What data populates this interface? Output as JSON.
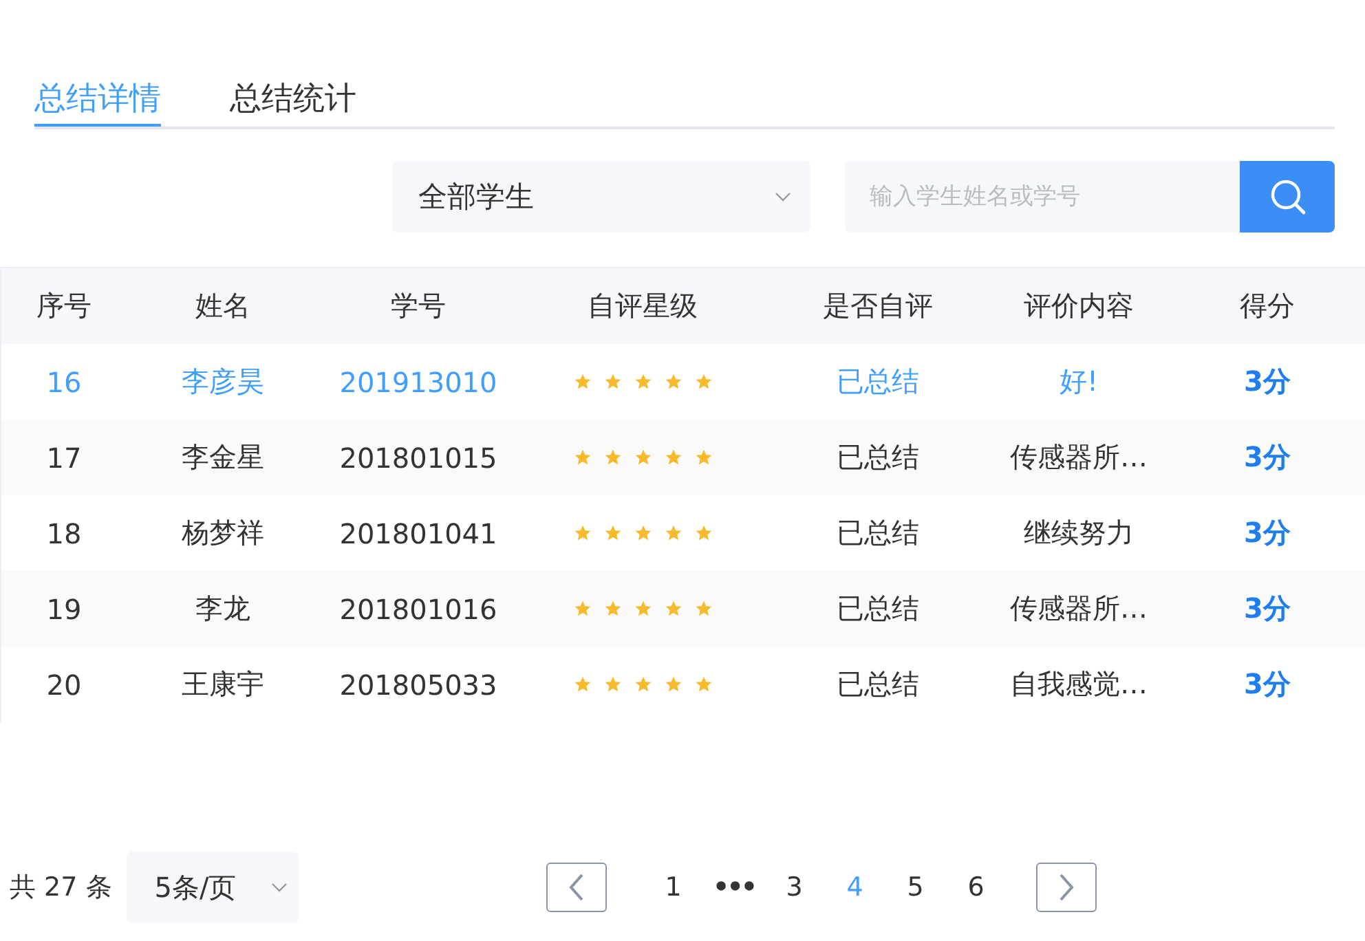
{
  "tabs": [
    {
      "label": "总结详情",
      "selected": true
    },
    {
      "label": "总结统计",
      "selected": false
    }
  ],
  "filter": {
    "value": "全部学生"
  },
  "search": {
    "placeholder": "输入学生姓名或学号"
  },
  "table": {
    "columns": [
      "序号",
      "姓名",
      "学号",
      "自评星级",
      "是否自评",
      "评价内容",
      "得分"
    ],
    "rows": [
      {
        "index": "16",
        "name": "李彦昊",
        "student_id": "201913010",
        "stars": 5,
        "status": "已总结",
        "comment": "好!",
        "score": "3分",
        "selected": true
      },
      {
        "index": "17",
        "name": "李金星",
        "student_id": "201801015",
        "stars": 5,
        "status": "已总结",
        "comment": "传感器所…",
        "score": "3分",
        "selected": false
      },
      {
        "index": "18",
        "name": "杨梦祥",
        "student_id": "201801041",
        "stars": 5,
        "status": "已总结",
        "comment": "继续努力",
        "score": "3分",
        "selected": false
      },
      {
        "index": "19",
        "name": "李龙",
        "student_id": "201801016",
        "stars": 5,
        "status": "已总结",
        "comment": "传感器所…",
        "score": "3分",
        "selected": false
      },
      {
        "index": "20",
        "name": "王康宇",
        "student_id": "201805033",
        "stars": 5,
        "status": "已总结",
        "comment": "自我感觉…",
        "score": "3分",
        "selected": false
      }
    ]
  },
  "pagination": {
    "total": "共 27 条",
    "page_size": "5条/页",
    "pages": [
      {
        "kind": "page",
        "label": "1",
        "selected": false
      },
      {
        "kind": "ellipsis",
        "label": "•••",
        "selected": false
      },
      {
        "kind": "page",
        "label": "3",
        "selected": false
      },
      {
        "kind": "page",
        "label": "4",
        "selected": true
      },
      {
        "kind": "page",
        "label": "5",
        "selected": false
      },
      {
        "kind": "page",
        "label": "6",
        "selected": false
      }
    ]
  }
}
